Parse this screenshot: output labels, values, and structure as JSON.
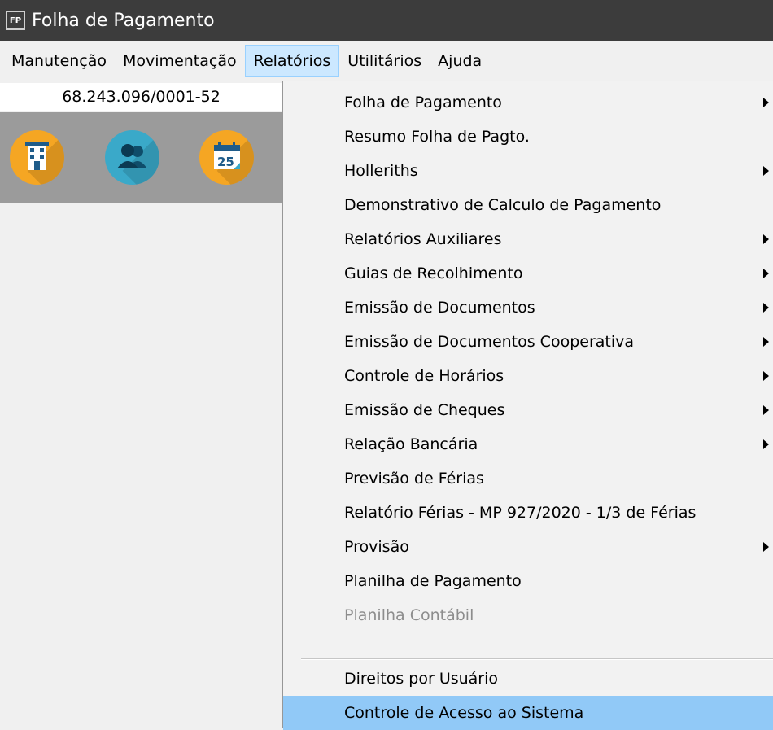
{
  "window": {
    "title": "Folha de Pagamento",
    "icon_text": "FP"
  },
  "menubar": {
    "items": [
      "Manutenção",
      "Movimentação",
      "Relatórios",
      "Utilitários",
      "Ajuda"
    ],
    "active": "Relatórios"
  },
  "company": {
    "cnpj": "68.243.096/0001-52"
  },
  "toolbar": {
    "icons": [
      {
        "name": "building-icon",
        "color": "#f5a623"
      },
      {
        "name": "users-icon",
        "color": "#3aa9c9"
      },
      {
        "name": "calendar-icon",
        "color": "#f5a623"
      }
    ]
  },
  "dropdown": {
    "items": [
      {
        "label": "Folha de Pagamento",
        "submenu": true
      },
      {
        "label": "Resumo Folha de Pagto.",
        "submenu": false
      },
      {
        "label": "Holleriths",
        "submenu": true
      },
      {
        "label": "Demonstrativo de Calculo de Pagamento",
        "submenu": false
      },
      {
        "label": "Relatórios Auxiliares",
        "submenu": true
      },
      {
        "label": "Guias de Recolhimento",
        "submenu": true
      },
      {
        "label": "Emissão de Documentos",
        "submenu": true
      },
      {
        "label": "Emissão de Documentos Cooperativa",
        "submenu": true
      },
      {
        "label": "Controle de Horários",
        "submenu": true
      },
      {
        "label": "Emissão de Cheques",
        "submenu": true
      },
      {
        "label": "Relação Bancária",
        "submenu": true
      },
      {
        "label": "Previsão de Férias",
        "submenu": false
      },
      {
        "label": "Relatório Férias - MP 927/2020 - 1/3 de Férias",
        "submenu": false
      },
      {
        "label": "Provisão",
        "submenu": true
      },
      {
        "label": "Planilha de Pagamento",
        "submenu": false
      },
      {
        "label": "Planilha Contábil",
        "submenu": false,
        "disabled": true
      },
      {
        "label": "Direitos por Usuário",
        "submenu": false
      },
      {
        "label": "Controle de Acesso ao Sistema",
        "submenu": false,
        "highlighted": true
      }
    ]
  }
}
